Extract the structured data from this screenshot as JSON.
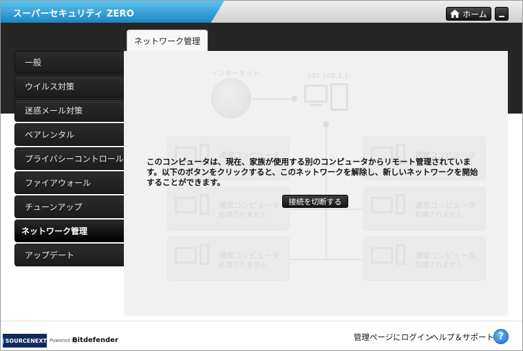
{
  "app": {
    "title": "スーパーセキュリティ ZERO"
  },
  "header": {
    "home_label": "ホーム"
  },
  "sidebar": {
    "items": [
      {
        "label": "一般"
      },
      {
        "label": "ウイルス対策"
      },
      {
        "label": "迷惑メール対策"
      },
      {
        "label": "ペアレンタル"
      },
      {
        "label": "プライバシーコントロール"
      },
      {
        "label": "ファイアウォール"
      },
      {
        "label": "チューンアップ"
      },
      {
        "label": "ネットワーク管理",
        "active": true
      },
      {
        "label": "アップデート"
      }
    ]
  },
  "main": {
    "tab_label": "ネットワーク管理",
    "internet_label": "インターネット",
    "ip_label": "192.168.1.1",
    "computers": [
      {
        "name": "通常コンピュータ",
        "status": ""
      },
      {
        "name": "通常コンピュータ",
        "status": ""
      },
      {
        "name": "通常コンピュータ",
        "status": "処理されません"
      },
      {
        "name": "通常コンピュータ",
        "status": "処理されません"
      },
      {
        "name": "通常コンピュータ",
        "status": "処理されません"
      },
      {
        "name": "通常コンピュータ",
        "status": "処理されません"
      }
    ],
    "message": "このコンピュータは、現在、家族が使用する別のコンピュータからリモート管理されています。以下のボタンをクリックすると、このネットワークを解除し、新しいネットワークを開始することができます。",
    "disconnect_label": "接続を切断する"
  },
  "footer": {
    "logo_text": "SOURCENEXT",
    "powered_by": "Powered by",
    "partner": "Bitdefender",
    "login_link": "管理ページにログイン",
    "help_link": "ヘルプ＆サポート",
    "help_icon_text": "?"
  },
  "colors": {
    "accent": "#1d86c4",
    "dark": "#262626"
  }
}
